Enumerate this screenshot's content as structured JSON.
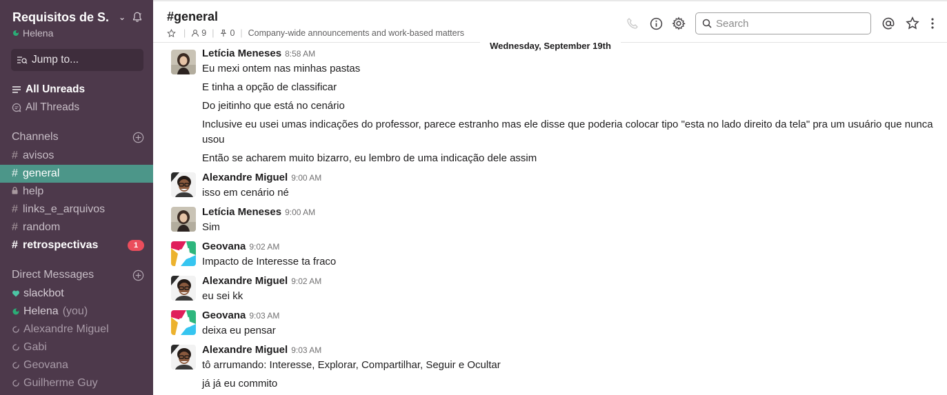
{
  "sidebar": {
    "team_name": "Requisitos de S...",
    "current_user": "Helena",
    "jump_to": "Jump to...",
    "all_unreads": "All Unreads",
    "all_threads": "All Threads",
    "channels_title": "Channels",
    "channels": [
      {
        "name": "avisos",
        "prefix": "#"
      },
      {
        "name": "general",
        "prefix": "#"
      },
      {
        "name": "help",
        "prefix": "lock"
      },
      {
        "name": "links_e_arquivos",
        "prefix": "#"
      },
      {
        "name": "random",
        "prefix": "#"
      },
      {
        "name": "retrospectivas",
        "prefix": "#",
        "badge": "1"
      }
    ],
    "dm_title": "Direct Messages",
    "dms": [
      {
        "name": "slackbot",
        "icon": "heart-icon"
      },
      {
        "name": "Helena",
        "suffix": "(you)",
        "icon": "presence-icon"
      },
      {
        "name": "Alexandre Miguel",
        "icon": "presence-icon"
      },
      {
        "name": "Gabi",
        "icon": "presence-icon"
      },
      {
        "name": "Geovana",
        "icon": "presence-icon"
      },
      {
        "name": "Guilherme Guy",
        "icon": "presence-icon"
      }
    ]
  },
  "header": {
    "title": "#general",
    "members": "9",
    "pinned": "0",
    "topic": "Company-wide announcements and work-based matters",
    "search_placeholder": "Search"
  },
  "day_divider": "Wednesday, September 19th",
  "messages": [
    {
      "author": "Letícia Meneses",
      "time": "8:58 AM",
      "avatar": "leticia",
      "lines": [
        "Eu mexi ontem nas minhas pastas",
        "E tinha a opção de classificar",
        "Do jeitinho que está no cenário",
        "Inclusive eu usei umas indicações do professor, parece estranho mas ele disse que poderia colocar tipo \"esta no lado direito da tela\" pra um usuário que nunca usou",
        "Então se acharem muito bizarro, eu lembro de uma indicação dele assim"
      ]
    },
    {
      "author": "Alexandre Miguel",
      "time": "9:00 AM",
      "avatar": "alexandre",
      "lines": [
        "isso em cenário né"
      ]
    },
    {
      "author": "Letícia Meneses",
      "time": "9:00 AM",
      "avatar": "leticia",
      "lines": [
        "Sim"
      ]
    },
    {
      "author": "Geovana",
      "time": "9:02 AM",
      "avatar": "geovana",
      "lines": [
        "Impacto de Interesse ta fraco"
      ]
    },
    {
      "author": "Alexandre Miguel",
      "time": "9:02 AM",
      "avatar": "alexandre",
      "lines": [
        "eu sei kk"
      ]
    },
    {
      "author": "Geovana",
      "time": "9:03 AM",
      "avatar": "geovana",
      "lines": [
        "deixa eu pensar"
      ]
    },
    {
      "author": "Alexandre Miguel",
      "time": "9:03 AM",
      "avatar": "alexandre",
      "lines": [
        "tô arrumando: Interesse, Explorar, Compartilhar, Seguir e Ocultar",
        "já já eu commito"
      ]
    }
  ]
}
